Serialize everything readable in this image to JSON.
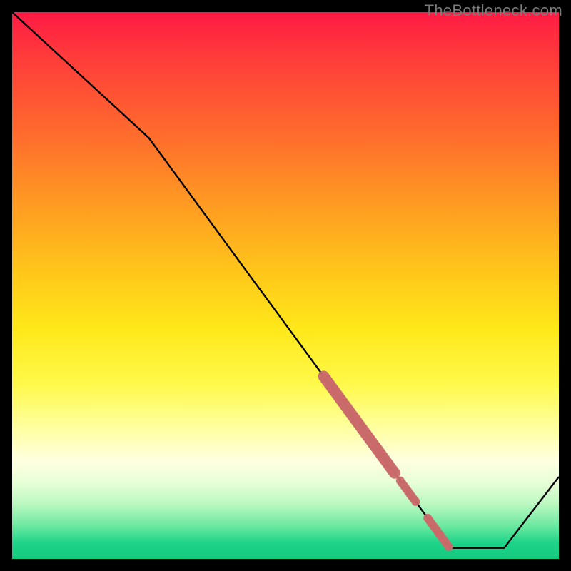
{
  "watermark": "TheBottleneck.com",
  "chart_data": {
    "type": "line",
    "title": "",
    "xlabel": "",
    "ylabel": "",
    "xlim": [
      0,
      100
    ],
    "ylim": [
      0,
      100
    ],
    "series": [
      {
        "name": "curve",
        "x": [
          0,
          25,
          80,
          90,
          100
        ],
        "values": [
          100,
          77,
          2,
          2,
          15
        ]
      }
    ],
    "marker_ranges": [
      {
        "x_start": 57,
        "x_end": 70,
        "thick": true
      },
      {
        "x_start": 71,
        "x_end": 74,
        "thick": false
      },
      {
        "x_start": 76,
        "x_end": 80,
        "thick": false
      }
    ],
    "marker_color": "#c96a6a",
    "line_color": "#000000"
  }
}
